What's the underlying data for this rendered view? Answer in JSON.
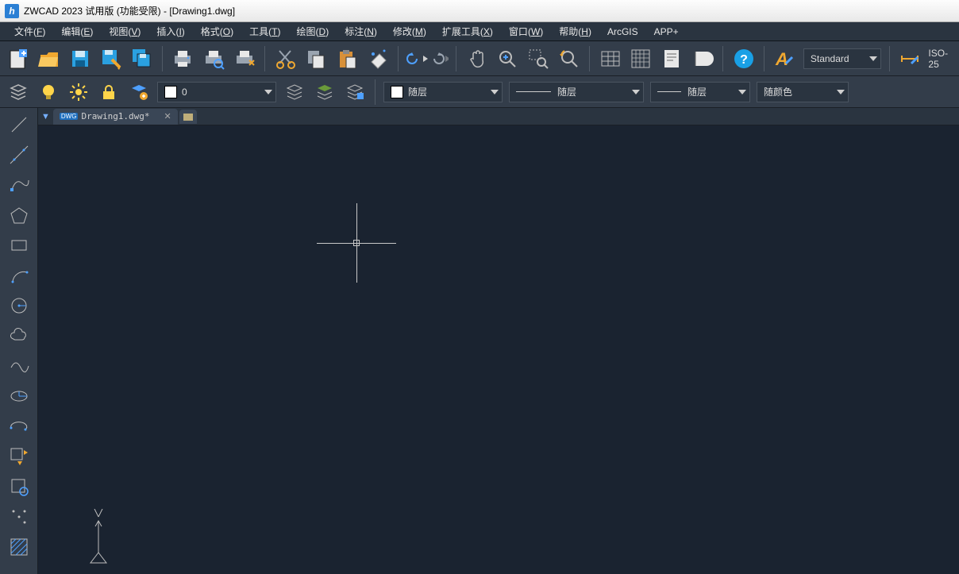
{
  "titlebar": {
    "app_initial": "h",
    "title": "ZWCAD 2023 试用版 (功能受限) - [Drawing1.dwg]"
  },
  "menu": {
    "items": [
      {
        "label": "文件",
        "key": "F"
      },
      {
        "label": "编辑",
        "key": "E"
      },
      {
        "label": "视图",
        "key": "V"
      },
      {
        "label": "插入",
        "key": "I"
      },
      {
        "label": "格式",
        "key": "O"
      },
      {
        "label": "工具",
        "key": "T"
      },
      {
        "label": "绘图",
        "key": "D"
      },
      {
        "label": "标注",
        "key": "N"
      },
      {
        "label": "修改",
        "key": "M"
      },
      {
        "label": "扩展工具",
        "key": "X"
      },
      {
        "label": "窗口",
        "key": "W"
      },
      {
        "label": "帮助",
        "key": "H"
      },
      {
        "label": "ArcGIS",
        "key": ""
      },
      {
        "label": "APP+",
        "key": ""
      }
    ]
  },
  "toolbar1": {
    "text_style": "Standard",
    "dim_style": "ISO-25"
  },
  "toolbar2": {
    "layer_value": "0",
    "linetype_label": "随层",
    "lineweight_label": "随层",
    "linestyle_label": "随层",
    "color_label": "随颜色"
  },
  "doc": {
    "tab_label": "Drawing1.dwg*",
    "badge": "DWG"
  },
  "colors": {
    "accent": "#4ea0ff",
    "folder": "#f0a830",
    "save": "#2aa0e0",
    "yellow": "#ffd54a",
    "eraser": "#e8e8e8",
    "help": "#19a0e6"
  }
}
